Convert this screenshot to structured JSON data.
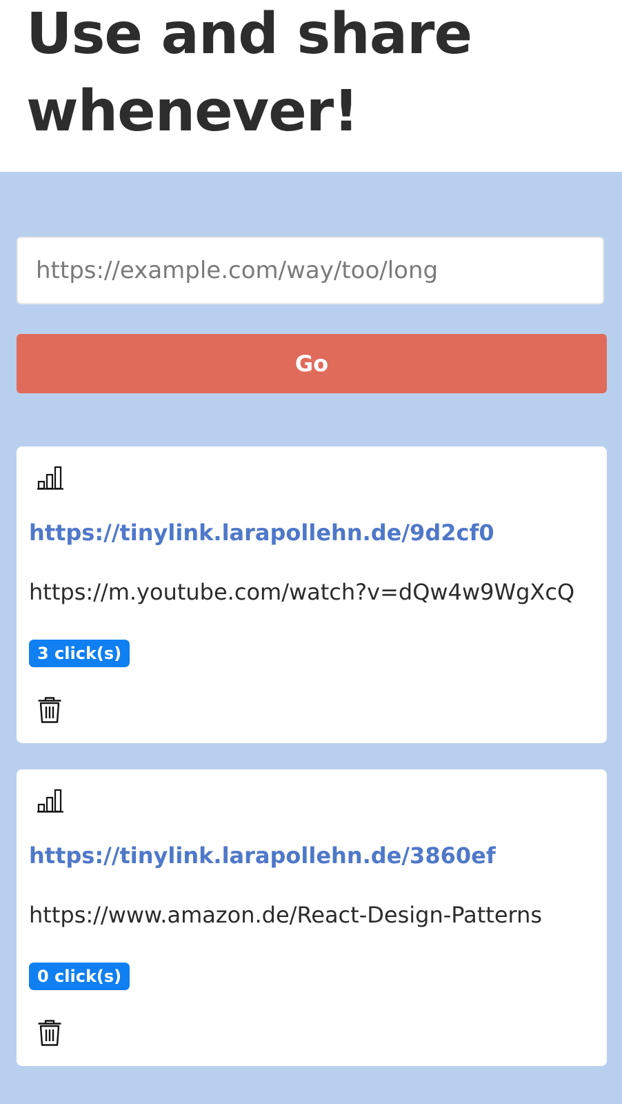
{
  "hero": {
    "title": "Use and share whenever!"
  },
  "form": {
    "url_placeholder": "https://example.com/way/too/long",
    "go_label": "Go"
  },
  "colors": {
    "background": "#b9cfee",
    "go_button": "#e06b5b",
    "short_link": "#4f78c9",
    "badge": "#0f7ff2"
  },
  "links": [
    {
      "short_url": "https://tinylink.larapollehn.de/9d2cf0",
      "long_url": "https://m.youtube.com/watch?v=dQw4w9WgXcQ",
      "clicks": "3 click(s)",
      "stats_icon": "bar-chart-icon",
      "delete_icon": "trash-icon"
    },
    {
      "short_url": "https://tinylink.larapollehn.de/3860ef",
      "long_url": "https://www.amazon.de/React-Design-Patterns",
      "clicks": "0 click(s)",
      "stats_icon": "bar-chart-icon",
      "delete_icon": "trash-icon"
    }
  ]
}
